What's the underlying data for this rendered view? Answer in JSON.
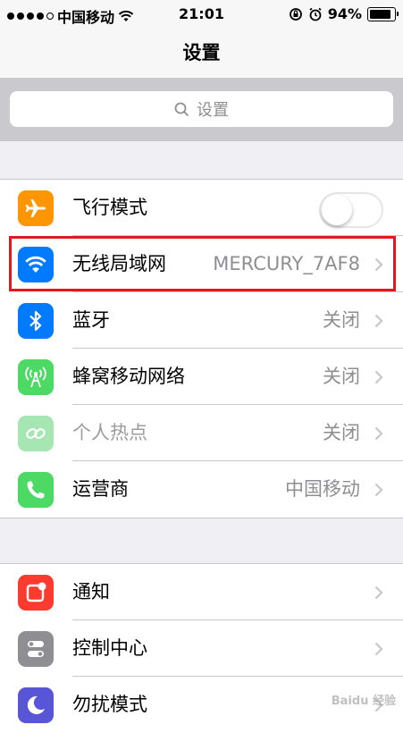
{
  "status_bar": {
    "carrier": "中国移动",
    "time": "21:01",
    "battery_percent": "94%",
    "battery_level": 0.94,
    "signal_bars": 4
  },
  "nav": {
    "title": "设置"
  },
  "search": {
    "placeholder": "设置"
  },
  "group1": [
    {
      "label": "飞行模式",
      "icon": "airplane-icon",
      "color": "#ff9500",
      "control": "toggle",
      "toggle_on": false
    },
    {
      "label": "无线局域网",
      "icon": "wifi-icon",
      "color": "#007aff",
      "value": "MERCURY_7AF8",
      "highlighted": true
    },
    {
      "label": "蓝牙",
      "icon": "bluetooth-icon",
      "color": "#007aff",
      "value": "关闭"
    },
    {
      "label": "蜂窝移动网络",
      "icon": "cellular-icon",
      "color": "#4cd964",
      "value": "关闭"
    },
    {
      "label": "个人热点",
      "icon": "hotspot-icon",
      "color": "#a5e6b2",
      "value": "关闭",
      "disabled": true
    },
    {
      "label": "运营商",
      "icon": "phone-icon",
      "color": "#4cd964",
      "value": "中国移动"
    }
  ],
  "group2": [
    {
      "label": "通知",
      "icon": "notifications-icon",
      "color": "#ff3b30"
    },
    {
      "label": "控制中心",
      "icon": "control-center-icon",
      "color": "#8e8e93"
    },
    {
      "label": "勿扰模式",
      "icon": "moon-icon",
      "color": "#5856d6"
    }
  ],
  "watermark": "Baidu 经验"
}
